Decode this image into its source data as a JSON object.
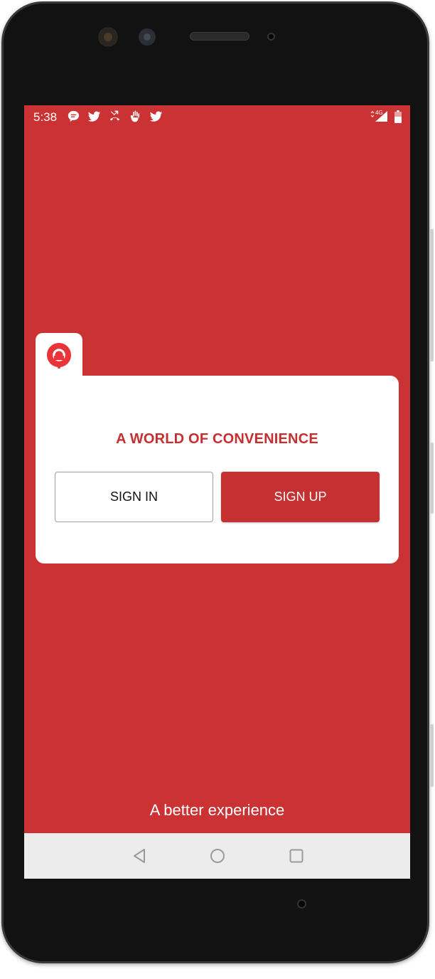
{
  "status_bar": {
    "time": "5:38",
    "notification_icons": [
      "chat-bubble-icon",
      "twitter-icon",
      "missed-call-icon",
      "hand-icon",
      "twitter-icon"
    ],
    "network_label": "4G",
    "right_icons": [
      "data-arrows-icon",
      "signal-icon",
      "battery-icon"
    ]
  },
  "card": {
    "logo_icon": "location-pin-logo",
    "tagline": "A WORLD OF CONVENIENCE",
    "sign_in_label": "SIGN IN",
    "sign_up_label": "SIGN UP"
  },
  "footer": {
    "text": "A better experience"
  },
  "navbar": {
    "buttons": [
      "back-icon",
      "home-icon",
      "recents-icon"
    ]
  },
  "colors": {
    "brand_red": "#cb3233",
    "button_red": "#c53031",
    "card_white": "#ffffff",
    "navbar_gray": "#ececec"
  }
}
